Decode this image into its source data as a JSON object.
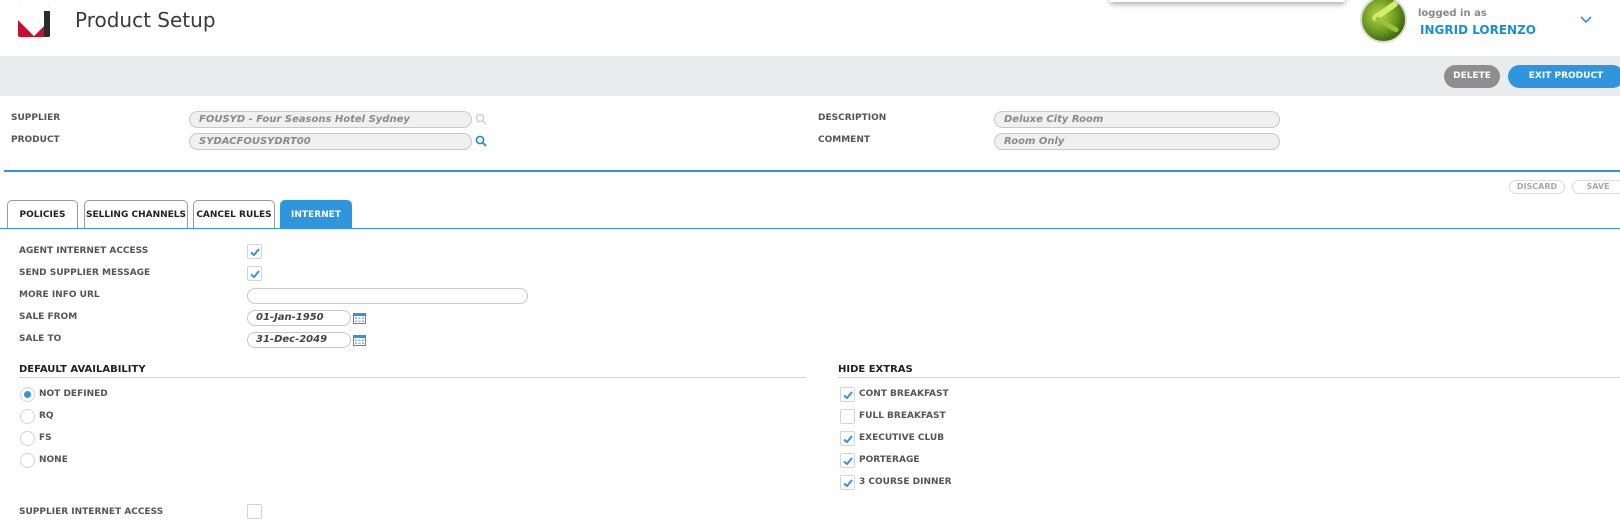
{
  "header": {
    "title": "Product Setup",
    "login_label": "logged in as",
    "user_name": "INGRID LORENZO"
  },
  "actions": {
    "delete": "DELETE",
    "exit": "EXIT PRODUCT"
  },
  "product_info": {
    "supplier_label": "SUPPLIER",
    "supplier_value": "FOUSYD - Four Seasons Hotel Sydney",
    "product_label": "PRODUCT",
    "product_value": "SYDACFOUSYDRT00",
    "description_label": "DESCRIPTION",
    "description_value": "Deluxe City Room",
    "comment_label": "COMMENT",
    "comment_value": "Room Only"
  },
  "form_actions": {
    "discard": "DISCARD",
    "save": "SAVE"
  },
  "tabs": [
    {
      "label": "POLICIES"
    },
    {
      "label": "SELLING CHANNELS"
    },
    {
      "label": "CANCEL RULES"
    },
    {
      "label": "INTERNET"
    }
  ],
  "internet": {
    "agent_access_label": "AGENT INTERNET ACCESS",
    "agent_access_checked": true,
    "send_supplier_msg_label": "SEND SUPPLIER MESSAGE",
    "send_supplier_msg_checked": true,
    "more_info_url_label": "MORE INFO URL",
    "more_info_url_value": "",
    "sale_from_label": "SALE FROM",
    "sale_from_value": "01-Jan-1950",
    "sale_to_label": "SALE TO",
    "sale_to_value": "31-Dec-2049",
    "default_availability": {
      "title": "DEFAULT AVAILABILITY",
      "options": [
        {
          "label": "NOT DEFINED",
          "selected": true
        },
        {
          "label": "RQ",
          "selected": false
        },
        {
          "label": "FS",
          "selected": false
        },
        {
          "label": "NONE",
          "selected": false
        }
      ]
    },
    "hide_extras": {
      "title": "HIDE EXTRAS",
      "items": [
        {
          "label": "CONT BREAKFAST",
          "checked": true
        },
        {
          "label": "FULL BREAKFAST",
          "checked": false
        },
        {
          "label": "EXECUTIVE CLUB",
          "checked": true
        },
        {
          "label": "PORTERAGE",
          "checked": true
        },
        {
          "label": "3 COURSE DINNER",
          "checked": true
        }
      ]
    },
    "supplier_access_label": "SUPPLIER INTERNET ACCESS",
    "supplier_access_checked": false
  },
  "colors": {
    "accent": "#2f95dc",
    "brand_red": "#c8102e",
    "delete_gray": "#8e8e8e"
  }
}
